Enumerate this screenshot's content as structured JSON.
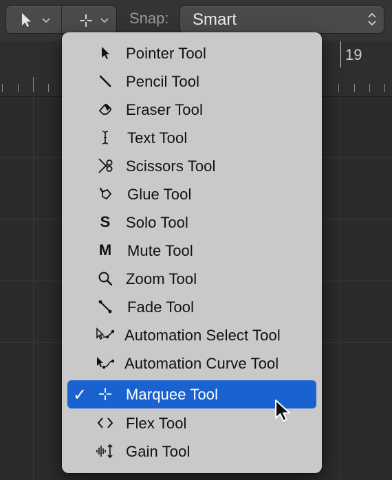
{
  "toolbar": {
    "left_tool_icon": "pointer-icon",
    "right_tool_icon": "crosshair-icon",
    "snap_label": "Snap:",
    "snap_value": "Smart"
  },
  "ruler": {
    "bar_number": "19"
  },
  "menu": {
    "items": [
      {
        "label": "Pointer Tool",
        "icon": "pointer-icon",
        "selected": false
      },
      {
        "label": "Pencil Tool",
        "icon": "pencil-icon",
        "selected": false
      },
      {
        "label": "Eraser Tool",
        "icon": "eraser-icon",
        "selected": false
      },
      {
        "label": "Text Tool",
        "icon": "text-cursor-icon",
        "selected": false
      },
      {
        "label": "Scissors Tool",
        "icon": "scissors-icon",
        "selected": false
      },
      {
        "label": "Glue Tool",
        "icon": "glue-icon",
        "selected": false
      },
      {
        "label": "Solo Tool",
        "icon": "solo-icon",
        "glyph": "S",
        "selected": false
      },
      {
        "label": "Mute Tool",
        "icon": "mute-icon",
        "glyph": "M",
        "selected": false
      },
      {
        "label": "Zoom Tool",
        "icon": "magnifier-icon",
        "selected": false
      },
      {
        "label": "Fade Tool",
        "icon": "fade-icon",
        "selected": false
      },
      {
        "label": "Automation Select Tool",
        "icon": "automation-select-icon",
        "selected": false
      },
      {
        "label": "Automation Curve Tool",
        "icon": "automation-curve-icon",
        "selected": false
      },
      {
        "label": "Marquee Tool",
        "icon": "crosshair-icon",
        "selected": true
      },
      {
        "label": "Flex Tool",
        "icon": "flex-icon",
        "selected": false
      },
      {
        "label": "Gain Tool",
        "icon": "gain-icon",
        "selected": false
      }
    ],
    "check_mark": "✓"
  },
  "colors": {
    "menu_background": "#c9c9c9",
    "selection": "#1a62cf",
    "workspace": "#2b2b2b"
  }
}
